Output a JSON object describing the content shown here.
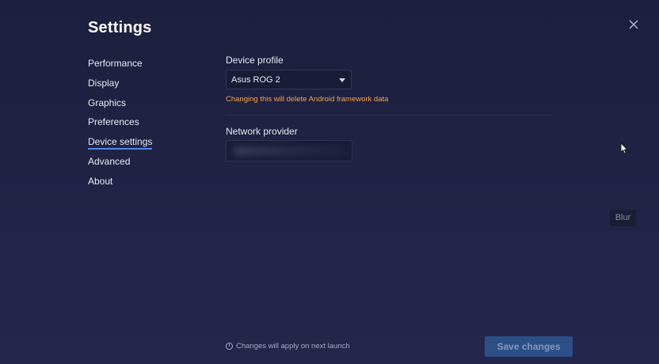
{
  "header": {
    "title": "Settings"
  },
  "sidebar": {
    "items": [
      {
        "label": "Performance"
      },
      {
        "label": "Display"
      },
      {
        "label": "Graphics"
      },
      {
        "label": "Preferences"
      },
      {
        "label": "Device settings",
        "active": true
      },
      {
        "label": "Advanced"
      },
      {
        "label": "About"
      }
    ]
  },
  "device_profile": {
    "label": "Device profile",
    "selected": "Asus ROG 2",
    "warning": "Changing this will delete Android framework data"
  },
  "network_provider": {
    "label": "Network provider",
    "value": ""
  },
  "overlay": {
    "blur_label": "Blur"
  },
  "footer": {
    "note": "Changes will apply on next launch",
    "save_label": "Save changes"
  },
  "colors": {
    "background": "#222447",
    "accent": "#4a8cf0",
    "warning": "#f0a44a",
    "save_button": "#2c4f86"
  },
  "icons": [
    "close-icon",
    "chevron-down-icon",
    "info-icon",
    "mouse-cursor-icon"
  ]
}
